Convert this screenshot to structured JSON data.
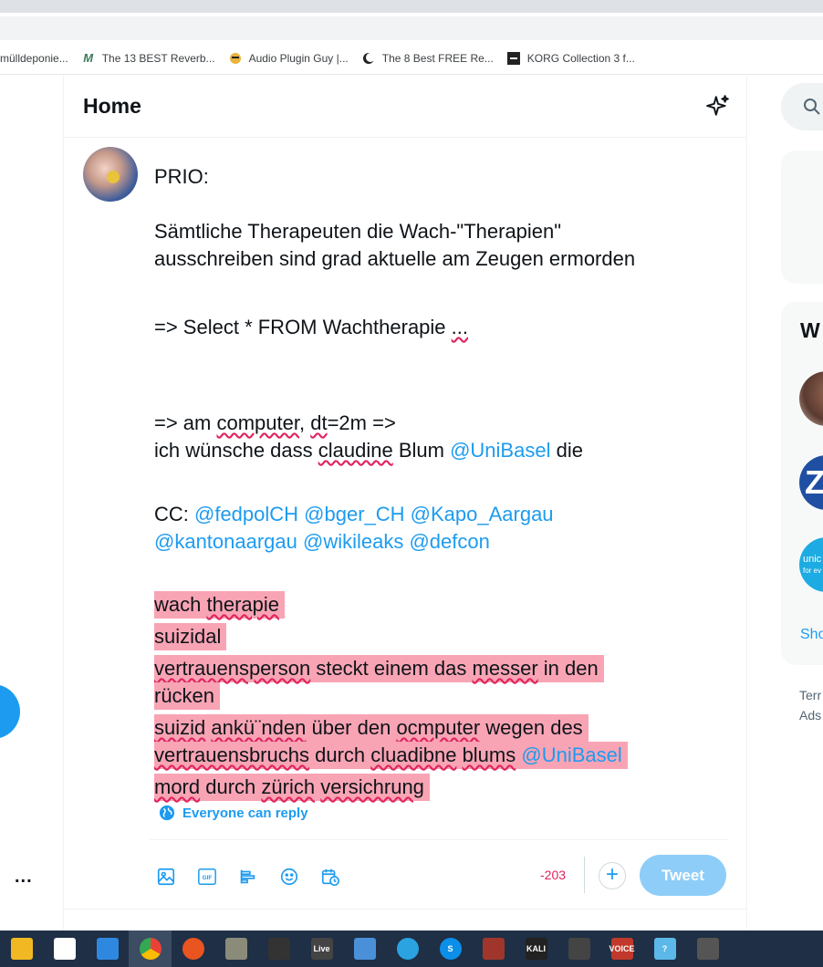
{
  "bookmarks": [
    {
      "label": "rmülldeponie...",
      "icon": "folder-icon"
    },
    {
      "label": "The 13 BEST Reverb...",
      "icon": "m-logo-icon"
    },
    {
      "label": "Audio Plugin Guy |...",
      "icon": "face-icon"
    },
    {
      "label": "The 8 Best FREE Re...",
      "icon": "moon-icon"
    },
    {
      "label": "KORG Collection 3 f...",
      "icon": "korg-icon"
    }
  ],
  "header": {
    "title": "Home"
  },
  "compose": {
    "l1": "PRIO:",
    "l2": "Sämtliche Therapeuten die Wach-\"Therapien\"",
    "l3": "ausschreiben sind grad aktuelle am Zeugen ermorden",
    "l4a": "=> Select * FROM Wachtherapie ",
    "l4b": "...",
    "l5a": "=> am ",
    "l5b": "computer",
    "l5c": ", ",
    "l5d": "dt",
    "l5e": "=2m =>",
    "l6a": "ich wünsche dass ",
    "l6b": "claudine",
    "l6c": " Blum ",
    "l6d": "@UniBasel",
    "l6e": " die",
    "l7a": "CC: ",
    "l7b": "@fedpolCH @bger_CH @Kapo_Aargau",
    "l8": "@kantonaargau @wikileaks @defcon",
    "h1a": "wach ",
    "h1b": "therapie",
    "h2": "suizidal",
    "h3a": "vertrauensperson",
    "h3b": " steckt einem das ",
    "h3c": "messer",
    "h3d": " in den",
    "h4": "rücken",
    "h5a": "suizid",
    "h5b": " ",
    "h5c": "ankü¨nden",
    "h5d": " über den ",
    "h5e": "ocmputer",
    "h5f": " wegen des",
    "h6a": "vertrauensbruchs",
    "h6b": " durch ",
    "h6c": "cluadibne",
    "h6d": " ",
    "h6e": "blums",
    "h6f": " ",
    "h6g": "@UniBasel",
    "h7a": "mord",
    "h7b": " durch ",
    "h7c": "zürich",
    "h7d": " ",
    "h7e": "versichrung"
  },
  "reply_setting": "Everyone can reply",
  "toolbar": {
    "icons": [
      "image-icon",
      "gif-icon",
      "poll-icon",
      "emoji-icon",
      "schedule-icon"
    ],
    "counter": "-203",
    "add": "+",
    "tweet_label": "Tweet"
  },
  "right": {
    "card_heading": "W",
    "show_more": "Sho",
    "ra2_letter": "Z",
    "ra3_text": "unic",
    "ra3_sub": "for ev",
    "terms_1": "Terr",
    "terms_2": "Ads"
  },
  "more_dots": "...",
  "taskbar": [
    {
      "icon": "file-explorer-icon",
      "color": "#f2b824"
    },
    {
      "icon": "store-icon",
      "color": "#ffffff"
    },
    {
      "icon": "mail-icon",
      "color": "#2f88e0"
    },
    {
      "icon": "chrome-icon",
      "color": "#e34133",
      "active": true
    },
    {
      "icon": "ubuntu-icon",
      "color": "#e95420"
    },
    {
      "icon": "bird-icon",
      "color": "#8b8b7a"
    },
    {
      "icon": "inkscape-icon",
      "color": "#333333"
    },
    {
      "icon": "live-icon",
      "color": "#444444",
      "label": "Live"
    },
    {
      "icon": "chat-icon",
      "color": "#4a90d9"
    },
    {
      "icon": "telegram-icon",
      "color": "#2aa3e0"
    },
    {
      "icon": "skype-icon",
      "color": "#0b8fe8",
      "label": "S"
    },
    {
      "icon": "circuit-icon",
      "color": "#a0362b"
    },
    {
      "icon": "kali-icon",
      "color": "#222222",
      "label": "KALI"
    },
    {
      "icon": "x-tool-icon",
      "color": "#444444"
    },
    {
      "icon": "voicemeeter-icon",
      "color": "#c0392b",
      "label": "VOICE"
    },
    {
      "icon": "help-icon",
      "color": "#5bb8e8",
      "label": "?"
    },
    {
      "icon": "app-icon",
      "color": "#555555"
    }
  ]
}
